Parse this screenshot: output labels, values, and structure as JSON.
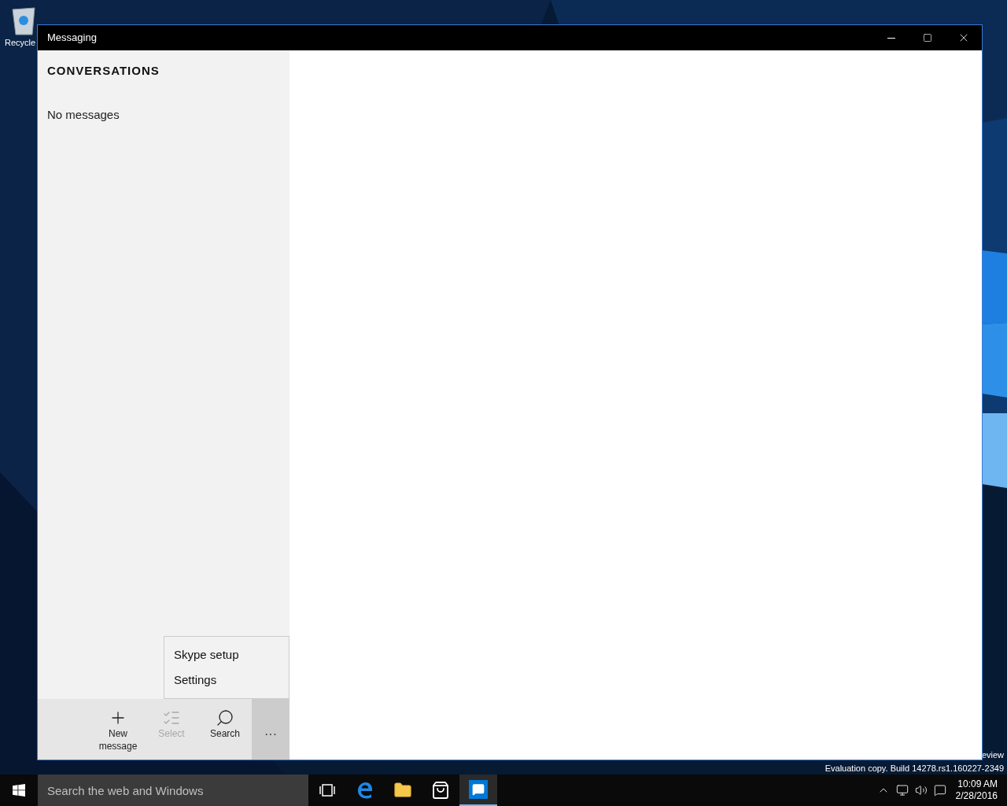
{
  "desktop": {
    "icons": [
      {
        "label": "Recycle"
      }
    ],
    "watermark_lines": [
      "eview",
      "Evaluation copy. Build 14278.rs1.160227-2349"
    ]
  },
  "window": {
    "title": "Messaging",
    "sidebar": {
      "heading": "CONVERSATIONS",
      "empty_text": "No messages"
    },
    "menu": [
      {
        "label": "Skype setup"
      },
      {
        "label": "Settings"
      }
    ],
    "app_bar": [
      {
        "kind": "add",
        "label": "New message",
        "disabled": false
      },
      {
        "kind": "select",
        "label": "Select",
        "disabled": true
      },
      {
        "kind": "search",
        "label": "Search",
        "disabled": false
      }
    ],
    "more": {
      "label": "···",
      "expanded": true
    }
  },
  "taskbar": {
    "search": {
      "placeholder": "Search the web and Windows"
    },
    "apps": [
      {
        "kind": "task-view",
        "selected": false
      },
      {
        "kind": "browser",
        "selected": false
      },
      {
        "kind": "folder",
        "selected": false
      },
      {
        "kind": "store",
        "selected": false
      },
      {
        "kind": "messaging",
        "selected": true
      }
    ],
    "clock": {
      "time": "10:09 AM",
      "date": "2/28/2016"
    }
  }
}
